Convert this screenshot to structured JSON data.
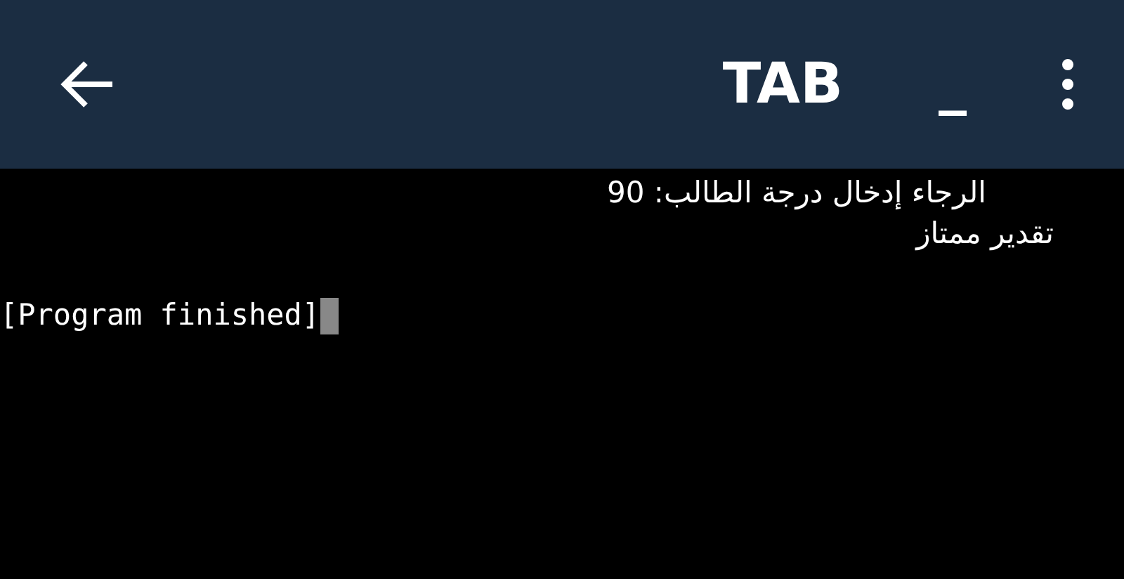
{
  "toolbar": {
    "title": "TAB",
    "extra_key": "_"
  },
  "terminal": {
    "lines": [
      "الرجاء إدخال درجة الطالب: 90",
      "تقدير ممتاز"
    ],
    "status": "[Program finished]"
  }
}
